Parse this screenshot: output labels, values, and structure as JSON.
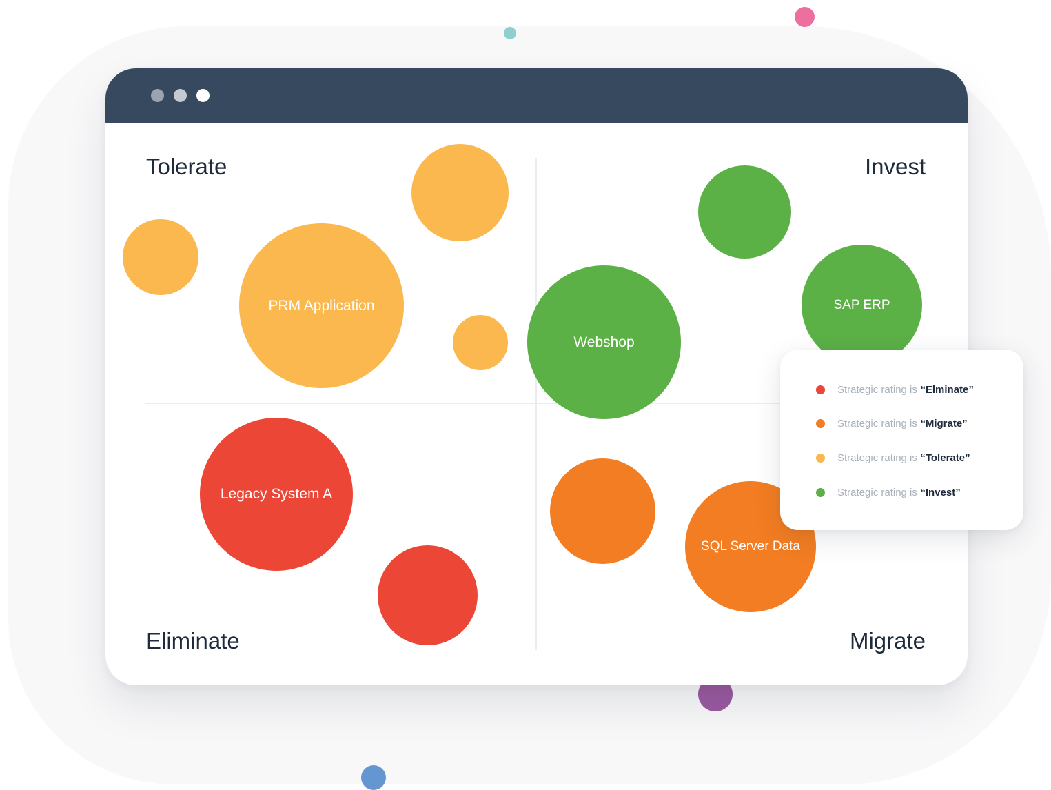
{
  "quadrants": {
    "top_left": "Tolerate",
    "top_right": "Invest",
    "bottom_left": "Eliminate",
    "bottom_right": "Migrate"
  },
  "bubbles": [
    {
      "label": "PRM Application",
      "rating": "Tolerate"
    },
    {
      "label": "Webshop",
      "rating": "Invest"
    },
    {
      "label": "SAP ERP",
      "rating": "Invest"
    },
    {
      "label": "Legacy System A",
      "rating": "Eliminate"
    },
    {
      "label": "SQL Server Data",
      "rating": "Migrate"
    }
  ],
  "legend": {
    "items": [
      {
        "prefix": "Strategic rating is",
        "value": "“Elminate”",
        "color": "#ec4637"
      },
      {
        "prefix": "Strategic rating is",
        "value": "“Migrate”",
        "color": "#f27d22"
      },
      {
        "prefix": "Strategic rating is",
        "value": "“Tolerate”",
        "color": "#fbb84f"
      },
      {
        "prefix": "Strategic rating is",
        "value": "“Invest”",
        "color": "#5bb046"
      }
    ]
  },
  "colors": {
    "eliminate": "#ec4637",
    "migrate": "#f27d22",
    "tolerate": "#fbb84f",
    "invest": "#5bb046",
    "titlebar": "#37495e"
  }
}
